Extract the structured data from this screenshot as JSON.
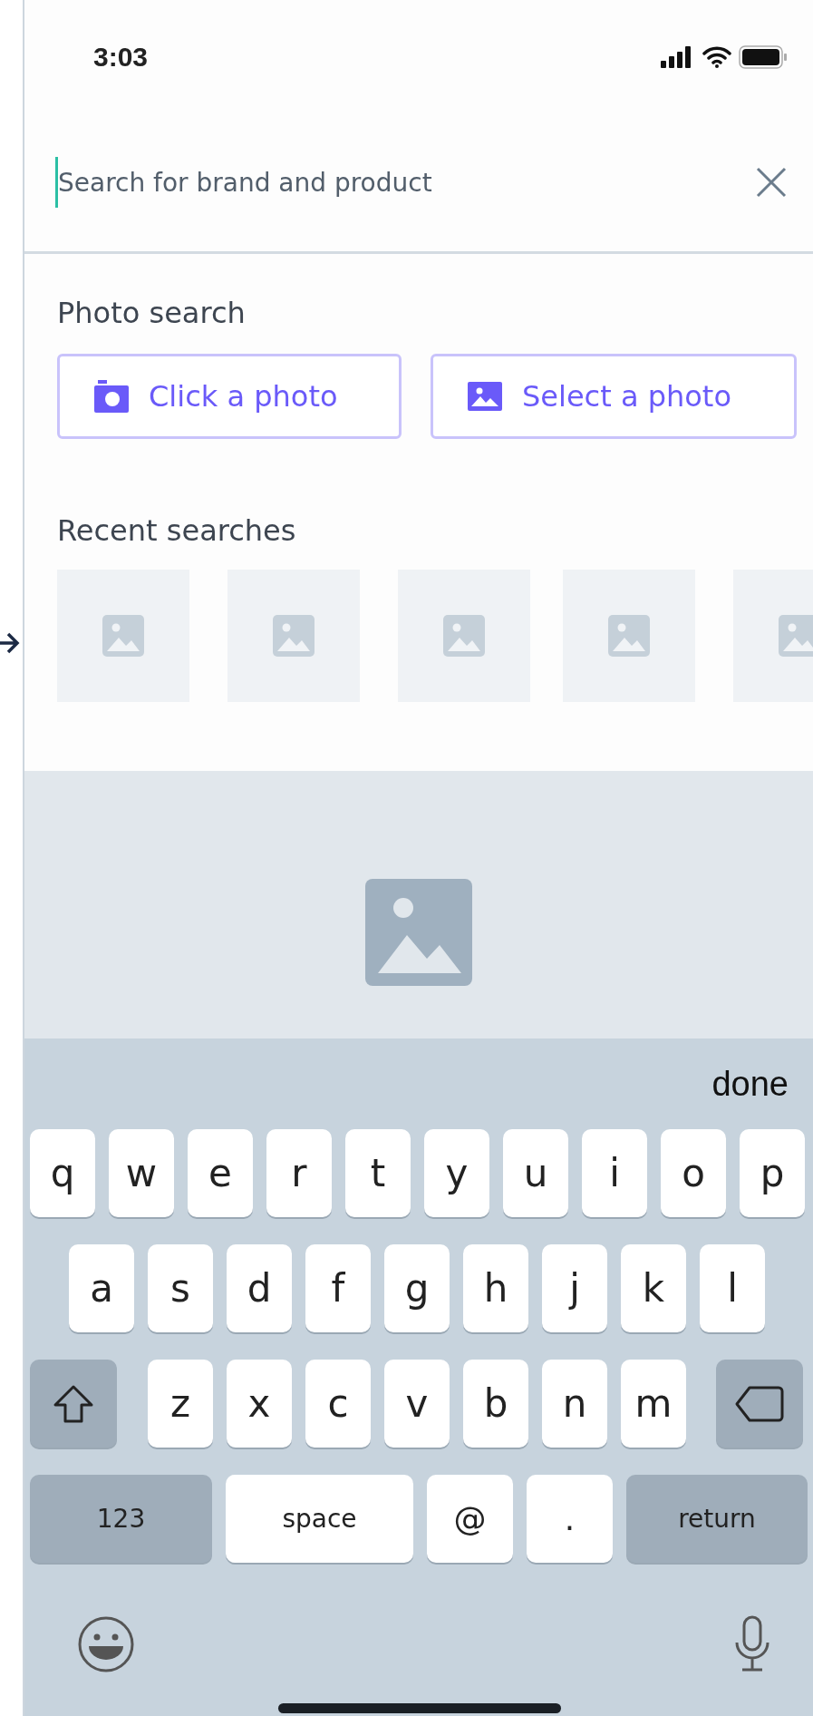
{
  "status_bar": {
    "time": "3:03"
  },
  "search": {
    "placeholder": "Search for brand and product",
    "focused": true
  },
  "photo_search": {
    "title": "Photo search",
    "buttons": [
      {
        "label": "Click a photo",
        "kind": "camera"
      },
      {
        "label": "Select a photo",
        "kind": "gallery"
      }
    ]
  },
  "recent_searches": {
    "title": "Recent searches",
    "items": [
      {
        "kind": "placeholder"
      },
      {
        "kind": "placeholder"
      },
      {
        "kind": "placeholder"
      },
      {
        "kind": "placeholder"
      },
      {
        "kind": "placeholder"
      }
    ]
  },
  "preview": {
    "kind": "placeholder"
  },
  "keyboard": {
    "done": "done",
    "rows": [
      [
        {
          "kind": "letter",
          "label": "q"
        },
        {
          "kind": "letter",
          "label": "w"
        },
        {
          "kind": "letter",
          "label": "e"
        },
        {
          "kind": "letter",
          "label": "r"
        },
        {
          "kind": "letter",
          "label": "t"
        },
        {
          "kind": "letter",
          "label": "y"
        },
        {
          "kind": "letter",
          "label": "u"
        },
        {
          "kind": "letter",
          "label": "i"
        },
        {
          "kind": "letter",
          "label": "o"
        },
        {
          "kind": "letter",
          "label": "p"
        }
      ],
      [
        {
          "kind": "letter",
          "label": "a"
        },
        {
          "kind": "letter",
          "label": "s"
        },
        {
          "kind": "letter",
          "label": "d"
        },
        {
          "kind": "letter",
          "label": "f"
        },
        {
          "kind": "letter",
          "label": "g"
        },
        {
          "kind": "letter",
          "label": "h"
        },
        {
          "kind": "letter",
          "label": "j"
        },
        {
          "kind": "letter",
          "label": "k"
        },
        {
          "kind": "letter",
          "label": "l"
        }
      ],
      [
        {
          "kind": "shift"
        },
        {
          "kind": "letter",
          "label": "z"
        },
        {
          "kind": "letter",
          "label": "x"
        },
        {
          "kind": "letter",
          "label": "c"
        },
        {
          "kind": "letter",
          "label": "v"
        },
        {
          "kind": "letter",
          "label": "b"
        },
        {
          "kind": "letter",
          "label": "n"
        },
        {
          "kind": "letter",
          "label": "m"
        },
        {
          "kind": "delete"
        }
      ]
    ],
    "bottom_row": [
      {
        "kind": "numbers",
        "label": "123"
      },
      {
        "kind": "space",
        "label": "space"
      },
      {
        "kind": "symbol",
        "label": "@"
      },
      {
        "kind": "symbol",
        "label": "."
      },
      {
        "kind": "return",
        "label": "return"
      }
    ]
  }
}
